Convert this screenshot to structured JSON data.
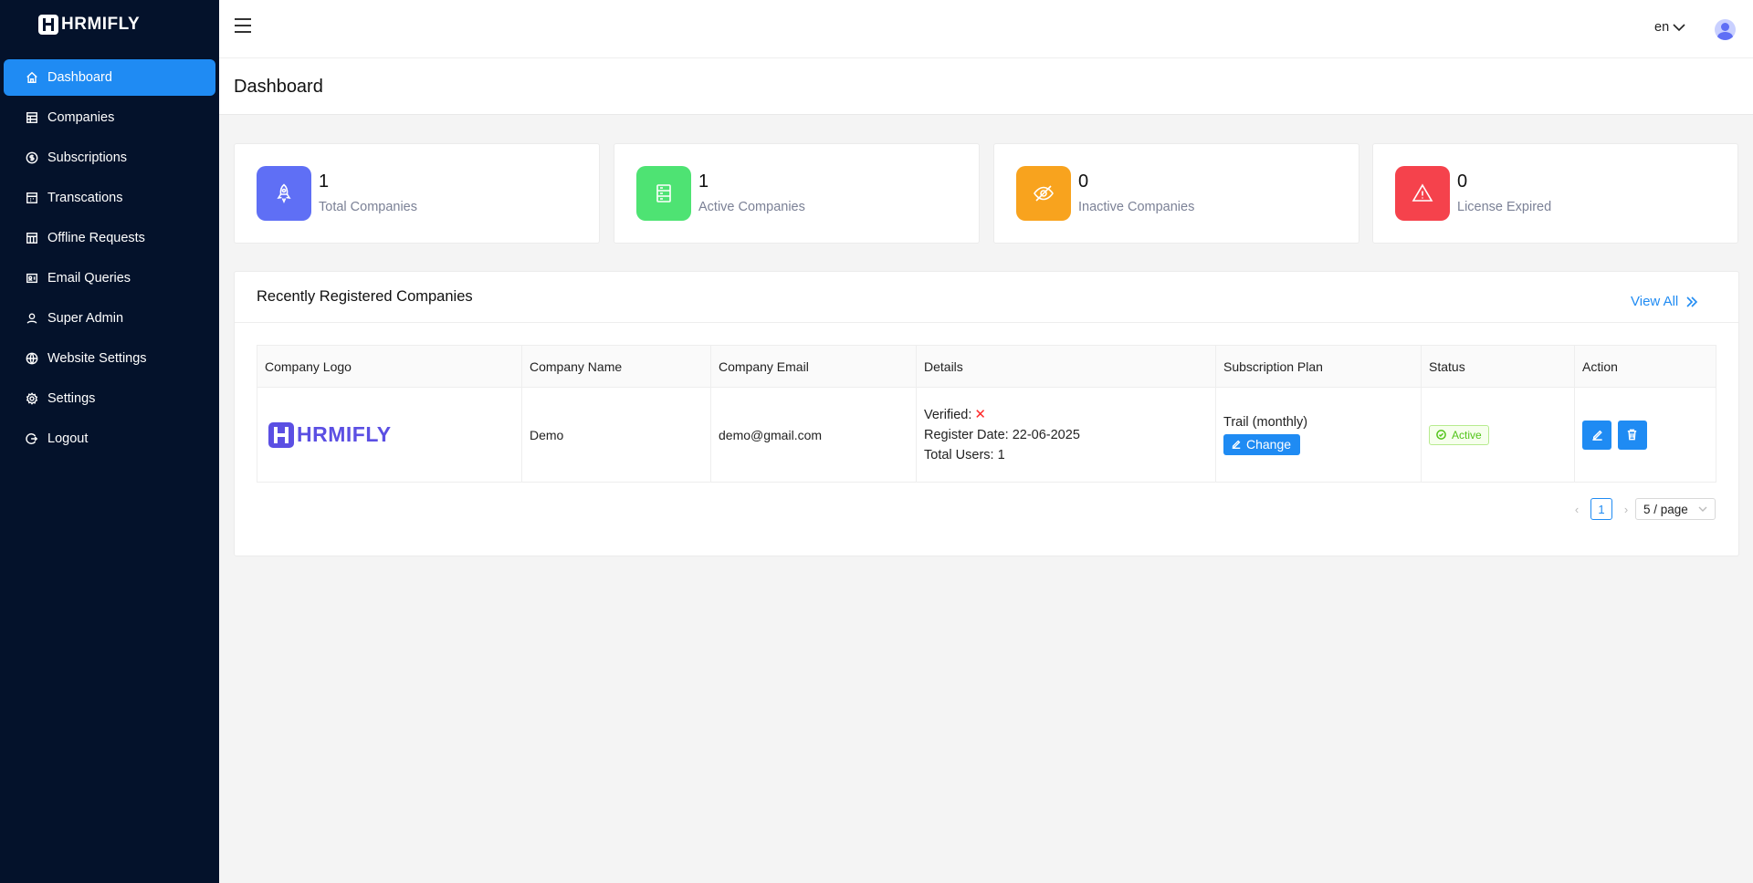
{
  "brand": {
    "name": "HRMIFLY"
  },
  "sidebar": {
    "items": [
      {
        "label": "Dashboard",
        "icon": "home-icon",
        "active": true
      },
      {
        "label": "Companies",
        "icon": "building-icon"
      },
      {
        "label": "Subscriptions",
        "icon": "dollar-icon"
      },
      {
        "label": "Transcations",
        "icon": "calendar-icon"
      },
      {
        "label": "Offline Requests",
        "icon": "calendar-icon"
      },
      {
        "label": "Email Queries",
        "icon": "mail-icon"
      },
      {
        "label": "Super Admin",
        "icon": "user-icon"
      },
      {
        "label": "Website Settings",
        "icon": "globe-icon"
      },
      {
        "label": "Settings",
        "icon": "gear-icon"
      },
      {
        "label": "Logout",
        "icon": "logout-icon"
      }
    ]
  },
  "header": {
    "language": "en"
  },
  "page": {
    "title": "Dashboard"
  },
  "stats": [
    {
      "value": "1",
      "label": "Total Companies",
      "color": "#5f6ff5",
      "icon": "rocket-icon"
    },
    {
      "value": "1",
      "label": "Active Companies",
      "color": "#4ee373",
      "icon": "server-icon"
    },
    {
      "value": "0",
      "label": "Inactive Companies",
      "color": "#f8a31e",
      "icon": "eye-off-icon"
    },
    {
      "value": "0",
      "label": "License Expired",
      "color": "#f5424c",
      "icon": "warning-icon"
    }
  ],
  "recent": {
    "title": "Recently Registered Companies",
    "view_all": "View All",
    "columns": [
      "Company Logo",
      "Company Name",
      "Company Email",
      "Details",
      "Subscription Plan",
      "Status",
      "Action"
    ],
    "rows": [
      {
        "logo_text": "HRMIFLY",
        "name": "Demo",
        "email": "demo@gmail.com",
        "verified_label": "Verified:",
        "register_date": "Register Date: 22-06-2025",
        "total_users": "Total Users: 1",
        "plan": "Trail (monthly)",
        "change_label": "Change",
        "status": "Active"
      }
    ]
  },
  "pagination": {
    "current_page": "1",
    "page_size": "5 / page"
  },
  "colors": {
    "accent": "#1f8bf3",
    "sidebar_bg": "#04122b",
    "brand_purple": "#5b4fe3"
  }
}
